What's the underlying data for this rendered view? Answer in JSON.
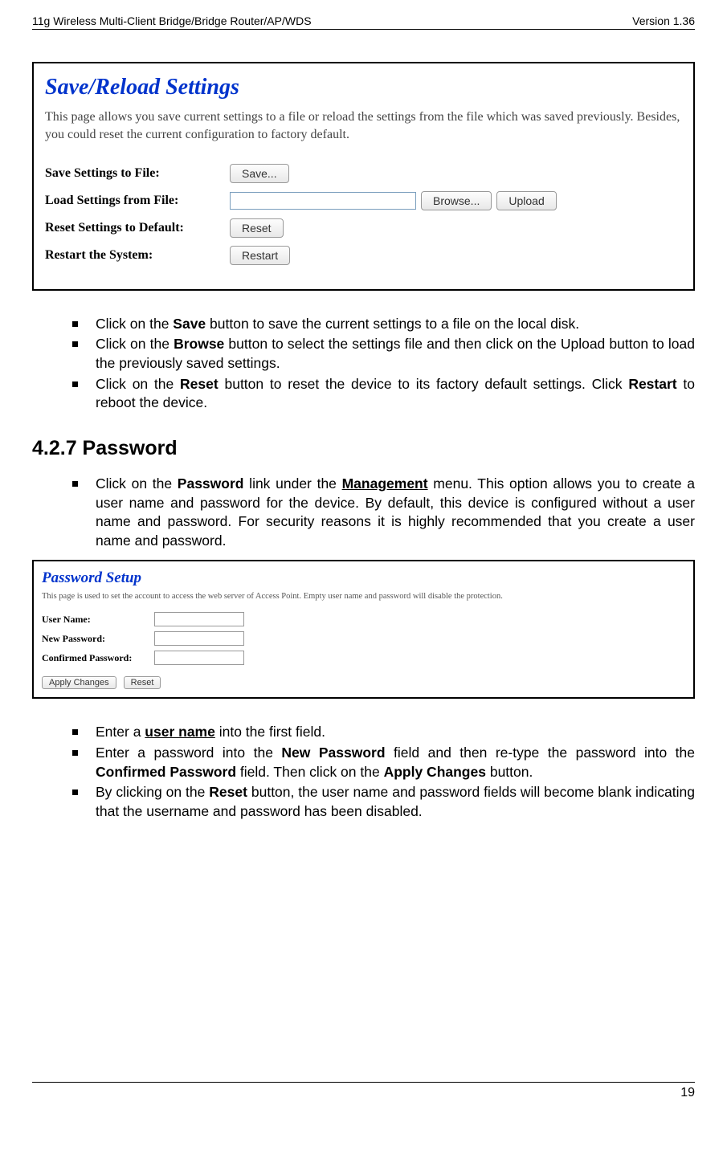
{
  "header": {
    "left": "11g Wireless Multi-Client Bridge/Bridge Router/AP/WDS",
    "right": "Version 1.36"
  },
  "screenshot1": {
    "title": "Save/Reload Settings",
    "subtitle": "This page allows you save current settings to a file or reload the settings from the file which was saved previously. Besides, you could reset the current configuration to factory default.",
    "rows": {
      "save_label": "Save Settings to File:",
      "save_btn": "Save...",
      "load_label": "Load Settings from File:",
      "browse_btn": "Browse...",
      "upload_btn": "Upload",
      "reset_label": "Reset Settings to Default:",
      "reset_btn": "Reset",
      "restart_label": "Restart the System:",
      "restart_btn": "Restart"
    }
  },
  "bullets1": {
    "b1_pre": "Click on the ",
    "b1_bold": "Save",
    "b1_post": " button to save the current settings to a file on the local disk.",
    "b2_pre": "Click on the ",
    "b2_bold": "Browse",
    "b2_post": " button to select the settings file and then click on the Upload button to load the previously saved settings.",
    "b3_pre": "Click on the ",
    "b3_bold1": "Reset",
    "b3_mid": " button to reset the device to its factory default settings. Click ",
    "b3_bold2": "Restart",
    "b3_post": " to reboot the device."
  },
  "section": {
    "heading": "4.2.7  Password"
  },
  "bullets2": {
    "b1_pre": "Click on the ",
    "b1_bold1": "Password",
    "b1_mid": " link under the ",
    "b1_bold2": "Management",
    "b1_post": " menu. This option allows you to create a user name and password for the device. By default, this device is configured without a user name and password. For security reasons it is highly recommended that you create a user name and password."
  },
  "screenshot2": {
    "title": "Password Setup",
    "subtitle": "This page is used to set the account to access the web server of Access Point. Empty user name and password will disable the protection.",
    "rows": {
      "user_label": "User Name:",
      "newpw_label": "New Password:",
      "confpw_label": "Confirmed Password:"
    },
    "apply_btn": "Apply Changes",
    "reset_btn": "Reset"
  },
  "bullets3": {
    "b1_pre": "Enter a ",
    "b1_bold": "user name",
    "b1_post": " into the first field.",
    "b2_pre": "Enter a password into the ",
    "b2_bold1": "New Password",
    "b2_mid": " field and then re-type the password into the ",
    "b2_bold2": "Confirmed Password",
    "b2_mid2": " field. Then click on the ",
    "b2_bold3": "Apply Changes",
    "b2_post": " button.",
    "b3_pre": "By clicking on the ",
    "b3_bold": "Reset",
    "b3_post": " button, the user name and password fields will become blank indicating that the username and password has been disabled."
  },
  "footer": {
    "page": "19"
  }
}
